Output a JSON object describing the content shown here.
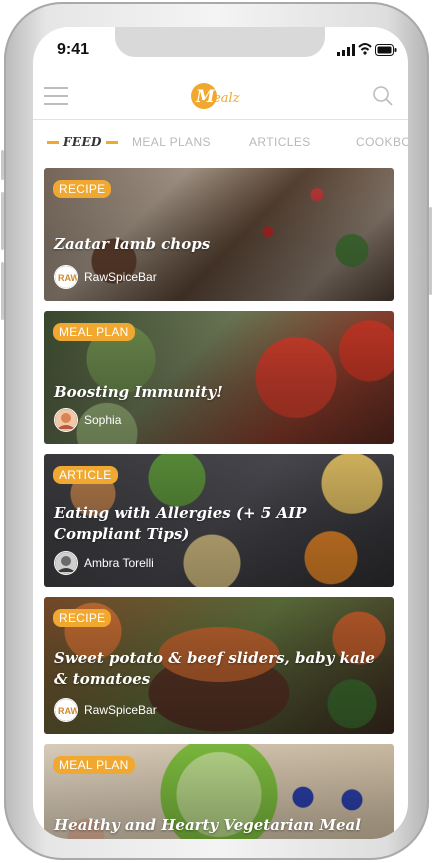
{
  "status": {
    "time": "9:41"
  },
  "app": {
    "logo_text": "Mealz"
  },
  "tabs": [
    {
      "label": "FEED",
      "active": true
    },
    {
      "label": "MEAL PLANS",
      "active": false
    },
    {
      "label": "ARTICLES",
      "active": false
    },
    {
      "label": "COOKBO",
      "active": false
    }
  ],
  "cards": [
    {
      "badge": "RECIPE",
      "title": "Zaatar lamb chops",
      "author": "RawSpiceBar",
      "avatar": "RawSpiceBar"
    },
    {
      "badge": "MEAL PLAN",
      "title": "Boosting Immunity!",
      "author": "Sophia",
      "avatar": "Sophia"
    },
    {
      "badge": "ARTICLE",
      "title": "Eating with Allergies (+ 5 AIP Compliant Tips)",
      "author": "Ambra Torelli",
      "avatar": "Ambra Torelli"
    },
    {
      "badge": "RECIPE",
      "title": "Sweet potato & beef sliders, baby kale & tomatoes",
      "author": "RawSpiceBar",
      "avatar": "RawSpiceBar"
    },
    {
      "badge": "MEAL PLAN",
      "title": "Healthy and Hearty Vegetarian Meal Plan",
      "author": "",
      "avatar": ""
    }
  ],
  "colors": {
    "accent": "#f0a830"
  }
}
